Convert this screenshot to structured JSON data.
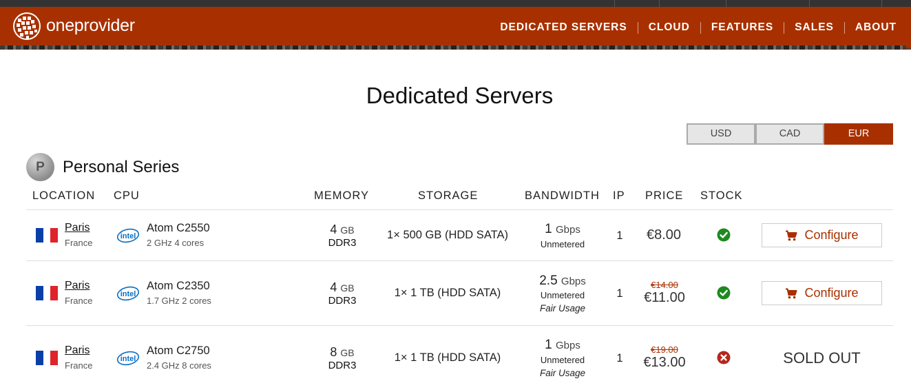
{
  "header": {
    "brand": "oneprovider",
    "menu": [
      "DEDICATED SERVERS",
      "CLOUD",
      "FEATURES",
      "SALES",
      "ABOUT"
    ]
  },
  "page": {
    "title": "Dedicated Servers"
  },
  "currency": {
    "options": [
      "USD",
      "CAD",
      "EUR"
    ],
    "selected": "EUR"
  },
  "series": {
    "badge": "P",
    "name": "Personal Series"
  },
  "columns": [
    "LOCATION",
    "CPU",
    "MEMORY",
    "STORAGE",
    "BANDWIDTH",
    "IP",
    "PRICE",
    "STOCK"
  ],
  "rows": [
    {
      "city": "Paris",
      "country": "France",
      "cpu": "Atom C2550",
      "cpu_spec": "2 GHz 4 cores",
      "mem_size": "4",
      "mem_unit": "GB",
      "mem_type": "DDR3",
      "storage": "1× 500 GB (HDD SATA)",
      "bw_value": "1",
      "bw_unit": "Gbps",
      "bw_sub": "Unmetered",
      "bw_fair": "",
      "ip": "1",
      "old_price": "",
      "price": "€8.00",
      "stock": "in-stock",
      "action": "Configure"
    },
    {
      "city": "Paris",
      "country": "France",
      "cpu": "Atom C2350",
      "cpu_spec": "1.7 GHz 2 cores",
      "mem_size": "4",
      "mem_unit": "GB",
      "mem_type": "DDR3",
      "storage": "1× 1 TB (HDD SATA)",
      "bw_value": "2.5",
      "bw_unit": "Gbps",
      "bw_sub": "Unmetered",
      "bw_fair": "Fair Usage",
      "ip": "1",
      "old_price": "€14.00",
      "price": "€11.00",
      "stock": "in-stock",
      "action": "Configure"
    },
    {
      "city": "Paris",
      "country": "France",
      "cpu": "Atom C2750",
      "cpu_spec": "2.4 GHz 8 cores",
      "mem_size": "8",
      "mem_unit": "GB",
      "mem_type": "DDR3",
      "storage": "1× 1 TB (HDD SATA)",
      "bw_value": "1",
      "bw_unit": "Gbps",
      "bw_sub": "Unmetered",
      "bw_fair": "Fair Usage",
      "ip": "1",
      "old_price": "€19.00",
      "price": "€13.00",
      "stock": "sold-out",
      "action": "SOLD OUT"
    }
  ],
  "colors": {
    "brand": "#a83000",
    "in_stock": "#1e8a1e",
    "sold_out": "#b3281e"
  },
  "icons": {
    "cart": "cart-icon",
    "check": "check-circle-icon",
    "cross": "x-circle-icon",
    "intel": "intel-logo-icon",
    "flag": "france-flag-icon"
  }
}
